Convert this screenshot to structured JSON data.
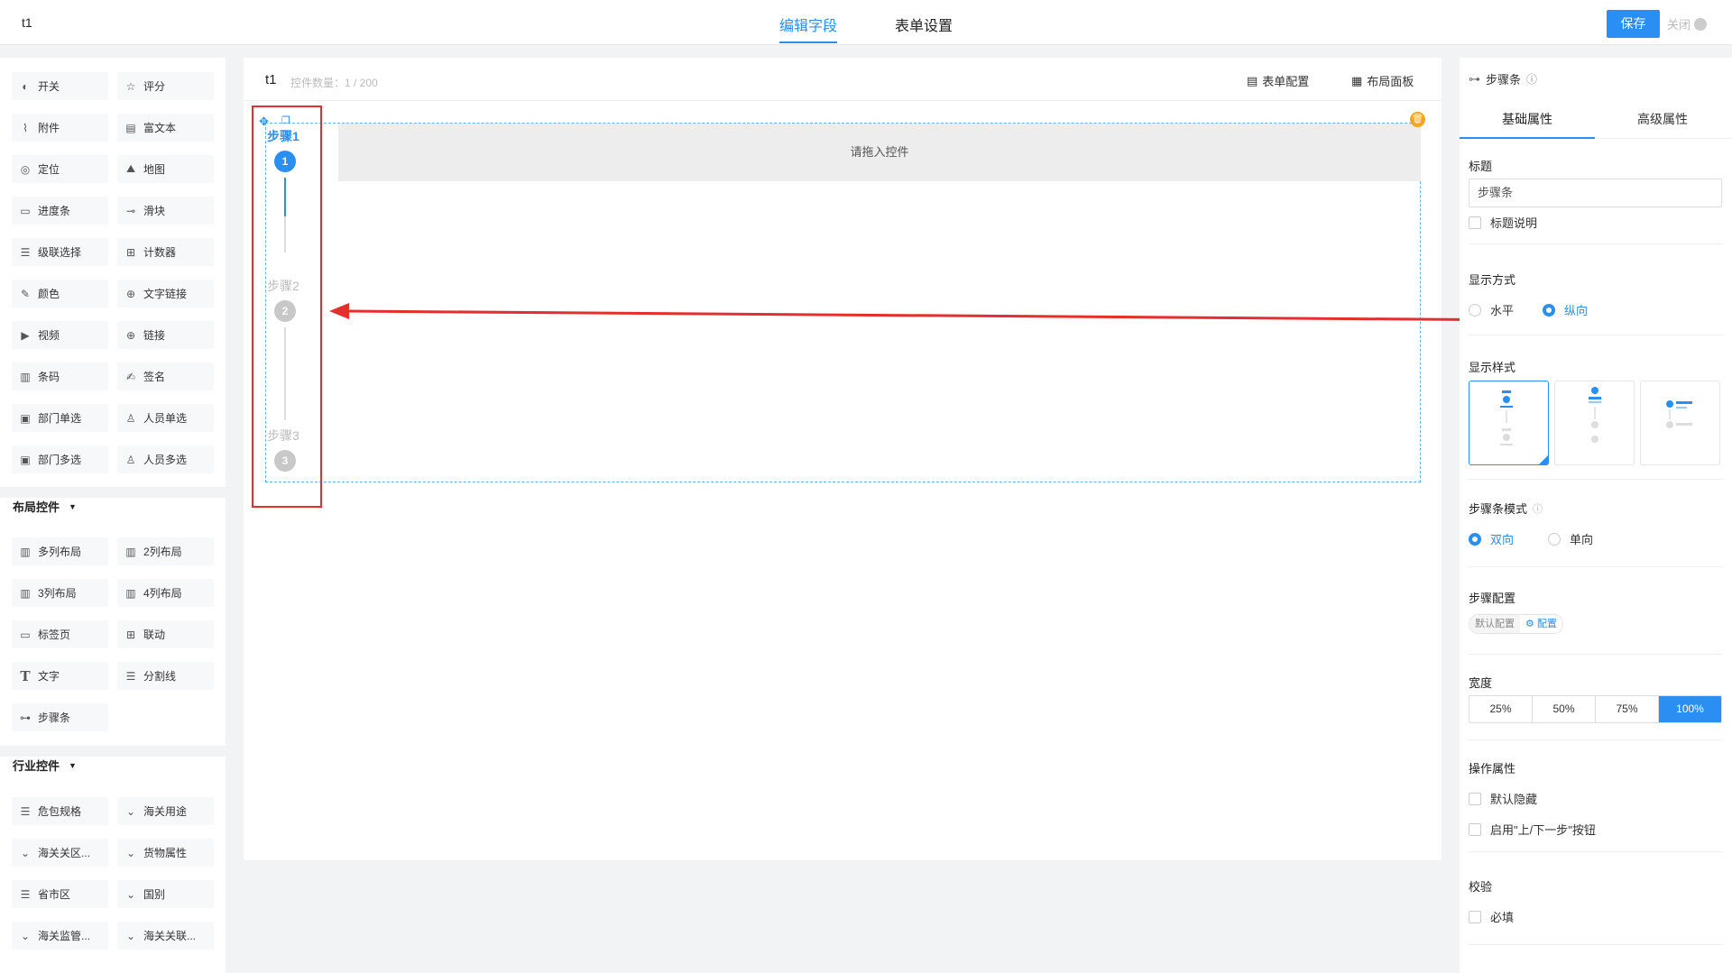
{
  "app": {
    "title": "t1"
  },
  "header": {
    "tabs": [
      {
        "label": "编辑字段"
      },
      {
        "label": "表单设置"
      }
    ],
    "save_label": "保存",
    "close_label": "关闭"
  },
  "palette": {
    "basic_items": [
      {
        "label": "开关",
        "icon": "toggle-icon"
      },
      {
        "label": "评分",
        "icon": "star-icon"
      },
      {
        "label": "附件",
        "icon": "paperclip-icon"
      },
      {
        "label": "富文本",
        "icon": "richtext-icon"
      },
      {
        "label": "定位",
        "icon": "location-icon"
      },
      {
        "label": "地图",
        "icon": "map-icon"
      },
      {
        "label": "进度条",
        "icon": "progress-icon"
      },
      {
        "label": "滑块",
        "icon": "slider-icon"
      },
      {
        "label": "级联选择",
        "icon": "cascade-icon"
      },
      {
        "label": "计数器",
        "icon": "counter-icon"
      },
      {
        "label": "颜色",
        "icon": "color-icon"
      },
      {
        "label": "文字链接",
        "icon": "globe-icon"
      },
      {
        "label": "视频",
        "icon": "video-icon"
      },
      {
        "label": "链接",
        "icon": "globe-icon"
      },
      {
        "label": "条码",
        "icon": "barcode-icon"
      },
      {
        "label": "签名",
        "icon": "signature-icon"
      },
      {
        "label": "部门单选",
        "icon": "dept-icon"
      },
      {
        "label": "人员单选",
        "icon": "user-icon"
      },
      {
        "label": "部门多选",
        "icon": "dept-multi-icon"
      },
      {
        "label": "人员多选",
        "icon": "users-icon"
      }
    ],
    "layout_group": {
      "title": "布局控件"
    },
    "layout_items": [
      {
        "label": "多列布局",
        "icon": "columns-icon"
      },
      {
        "label": "2列布局",
        "icon": "columns-icon"
      },
      {
        "label": "3列布局",
        "icon": "columns-icon"
      },
      {
        "label": "4列布局",
        "icon": "columns-icon"
      },
      {
        "label": "标签页",
        "icon": "tabs-icon"
      },
      {
        "label": "联动",
        "icon": "link-grid-icon"
      },
      {
        "label": "文字",
        "icon": "text-icon"
      },
      {
        "label": "分割线",
        "icon": "divider-icon"
      },
      {
        "label": "步骤条",
        "icon": "steps-icon"
      }
    ],
    "industry_group": {
      "title": "行业控件"
    },
    "industry_items": [
      {
        "label": "危包规格",
        "icon": "list-icon"
      },
      {
        "label": "海关用途",
        "icon": "chevron-down-icon"
      },
      {
        "label": "海关关区...",
        "icon": "chevron-down-icon"
      },
      {
        "label": "货物属性",
        "icon": "chevron-down-icon"
      },
      {
        "label": "省市区",
        "icon": "list-icon"
      },
      {
        "label": "国别",
        "icon": "chevron-down-icon"
      },
      {
        "label": "海关监管...",
        "icon": "chevron-down-icon"
      },
      {
        "label": "海关关联...",
        "icon": "chevron-down-icon"
      }
    ]
  },
  "canvas": {
    "title": "t1",
    "count_label": "控件数量：1 / 200",
    "form_config": "表单配置",
    "layout_panel": "布局面板",
    "drop_placeholder": "请拖入控件",
    "steps": [
      {
        "label": "步骤1",
        "num": "1"
      },
      {
        "label": "步骤2",
        "num": "2"
      },
      {
        "label": "步骤3",
        "num": "3"
      }
    ]
  },
  "props": {
    "header": "步骤条",
    "tabs": [
      {
        "label": "基础属性"
      },
      {
        "label": "高级属性"
      }
    ],
    "title_section": "标题",
    "title_value": "步骤条",
    "title_desc": "标题说明",
    "display_mode": "显示方式",
    "mode_options": [
      "水平",
      "纵向"
    ],
    "mode_selected": "纵向",
    "display_style": "显示样式",
    "steps_mode": "步骤条模式",
    "steps_mode_options": [
      "双向",
      "单向"
    ],
    "steps_mode_selected": "双向",
    "steps_config": "步骤配置",
    "steps_config_default": "默认配置",
    "steps_config_btn": "配置",
    "width_title": "宽度",
    "width_options": [
      "25%",
      "50%",
      "75%",
      "100%"
    ],
    "width_selected": "100%",
    "op_title": "操作属性",
    "op_hide": "默认隐藏",
    "op_prevnext": "启用\"上/下一步\"按钮",
    "validate_title": "校验",
    "validate_required": "必填"
  },
  "colors": {
    "accent": "#2b8ef3",
    "annotation": "#e52e2e",
    "delete": "#f5a623"
  }
}
